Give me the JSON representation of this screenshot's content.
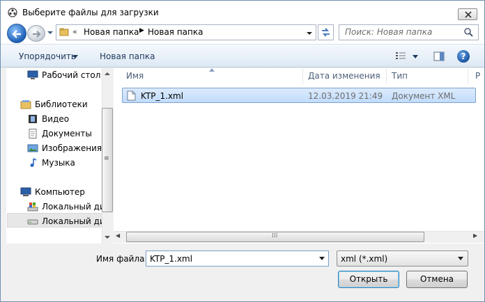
{
  "window": {
    "title": "Выберите файлы для загрузки"
  },
  "nav": {
    "address_overflow": "«",
    "breadcrumbs": [
      "Новая папка",
      "Новая папка"
    ],
    "search_placeholder": "Поиск: Новая папка"
  },
  "toolbar": {
    "organize_label": "Упорядочить",
    "new_folder_label": "Новая папка"
  },
  "sidebar": {
    "items": [
      {
        "label": "Рабочий стол",
        "icon": "desktop-icon"
      },
      {
        "label": "Библиотеки",
        "icon": "libraries-icon"
      },
      {
        "label": "Видео",
        "icon": "video-icon"
      },
      {
        "label": "Документы",
        "icon": "documents-icon"
      },
      {
        "label": "Изображения",
        "icon": "pictures-icon"
      },
      {
        "label": "Музыка",
        "icon": "music-icon"
      },
      {
        "label": "Компьютер",
        "icon": "computer-icon"
      },
      {
        "label": "Локальный дис",
        "icon": "system-drive-icon"
      },
      {
        "label": "Локальный дис",
        "icon": "drive-icon",
        "selected": true
      }
    ],
    "scroll_grip": "≡"
  },
  "file_list": {
    "columns": [
      "Имя",
      "Дата изменения",
      "Тип",
      "Р"
    ],
    "rows": [
      {
        "name": "KTP_1.xml",
        "date": "12.03.2019 21:49",
        "type": "Документ XML",
        "selected": true
      }
    ],
    "hscroll_grip": "⁞⁞⁞"
  },
  "footer": {
    "filename_label": "Имя файла:",
    "filename_value": "KTP_1.xml",
    "filetype_value": "xml (*.xml)",
    "open_label": "Открыть",
    "cancel_label": "Отмена"
  },
  "colors": {
    "selection_fill": "#c9e0fc",
    "selection_border": "#7da2ce",
    "toolbar_text": "#1e395b",
    "header_text": "#4c607a"
  }
}
